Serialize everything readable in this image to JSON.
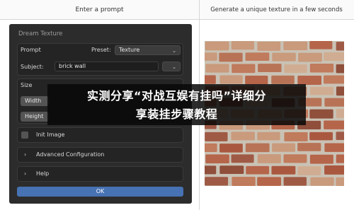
{
  "header": {
    "left_title": "Enter a prompt",
    "right_title": "Generate a unique texture in a few seconds"
  },
  "panel": {
    "title": "Dream Texture",
    "prompt_label": "Prompt",
    "preset_label": "Preset:",
    "preset_value": "Texture",
    "subject_label": "Subject:",
    "subject_value": "brick wall",
    "size_label": "Size",
    "width_label": "Width",
    "height_label": "Height",
    "init_image_label": "Init Image",
    "advanced_label": "Advanced Configuration",
    "help_label": "Help",
    "ok_label": "OK"
  },
  "icons": {
    "dropdown": "chevron-down-icon",
    "expand": "chevron-right-icon"
  },
  "overlay": {
    "line1": "实测分享“对战互娱有挂吗”详细分",
    "line2": "享装挂步骤教程"
  },
  "colors": {
    "panel_bg": "#2c2c2c",
    "ok_button": "#4772b3",
    "brick": "#b5654a",
    "mortar": "#c9c2b5"
  }
}
